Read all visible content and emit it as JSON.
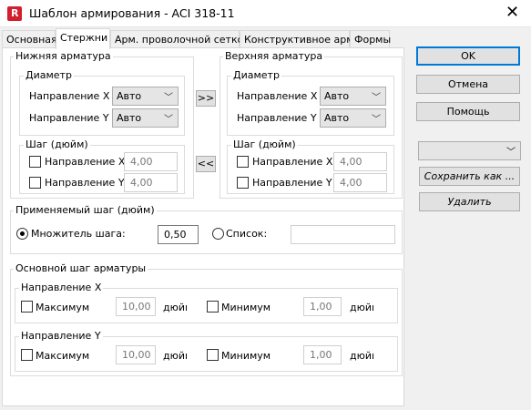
{
  "window": {
    "title": "Шаблон армирования - ACI 318-11",
    "app_icon_letter": "R"
  },
  "tabs": [
    {
      "label": "Основная",
      "active": false
    },
    {
      "label": "Стержни",
      "active": true
    },
    {
      "label": "Арм. проволочной сеткой",
      "active": false
    },
    {
      "label": "Конструктивное арм.",
      "active": false
    },
    {
      "label": "Формы",
      "active": false
    }
  ],
  "bottom_rebar": {
    "title": "Нижняя арматура",
    "diameter": {
      "title": "Диаметр",
      "dir_x_label": "Направление X",
      "dir_x_value": "Авто",
      "dir_y_label": "Направление Y",
      "dir_y_value": "Авто"
    },
    "spacing": {
      "title": "Шаг (дюйм)",
      "dir_x_label": "Направление X",
      "dir_x_value": "4,00",
      "dir_y_label": "Направление Y",
      "dir_y_value": "4,00"
    }
  },
  "top_rebar": {
    "title": "Верхняя арматура",
    "diameter": {
      "title": "Диаметр",
      "dir_x_label": "Направление X",
      "dir_x_value": "Авто",
      "dir_y_label": "Направление Y",
      "dir_y_value": "Авто"
    },
    "spacing": {
      "title": "Шаг (дюйм)",
      "dir_x_label": "Направление X",
      "dir_x_value": "4,00",
      "dir_y_label": "Направление Y",
      "dir_y_value": "4,00"
    }
  },
  "copy_buttons": {
    "to_top": ">>",
    "to_bottom": "<<"
  },
  "applied_spacing": {
    "title": "Применяемый шаг (дюйм)",
    "multiplier_label": "Множитель шага:",
    "multiplier_value": "0,50",
    "list_label": "Список:",
    "list_value": ""
  },
  "base_spacing": {
    "title": "Основной шаг арматуры",
    "dir_x": {
      "title": "Направление X",
      "max_label": "Максимум",
      "max_value": "10,00",
      "max_unit": "дюйı",
      "min_label": "Минимум",
      "min_value": "1,00",
      "min_unit": "дюйı"
    },
    "dir_y": {
      "title": "Направление Y",
      "max_label": "Максимум",
      "max_value": "10,00",
      "max_unit": "дюйı",
      "min_label": "Минимум",
      "min_value": "1,00",
      "min_unit": "дюйı"
    }
  },
  "buttons": {
    "ok": "OK",
    "cancel": "Отмена",
    "help": "Помощь",
    "save_as": "Сохранить как ...",
    "delete": "Удалить"
  },
  "colors": {
    "accent": "#0078d7",
    "app_icon": "#d11f2e"
  }
}
